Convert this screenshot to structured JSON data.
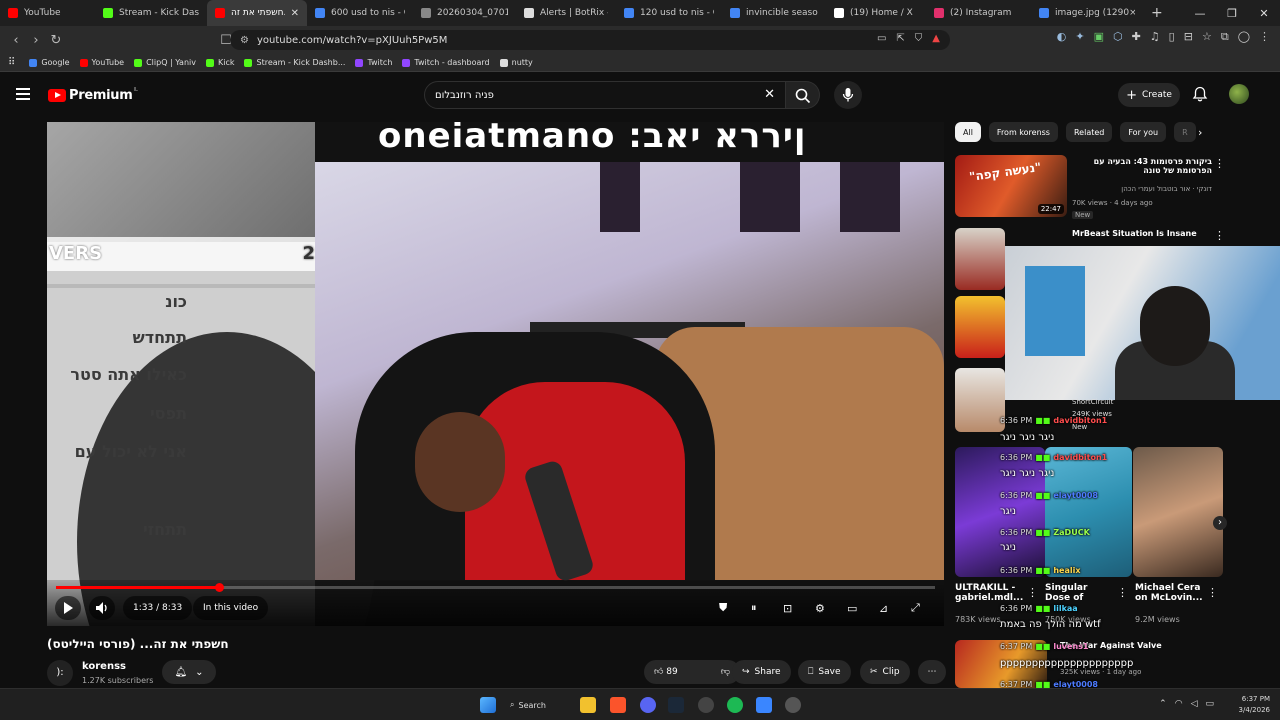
{
  "browser": {
    "tabs": [
      {
        "label": "YouTube",
        "color": "#ff0000",
        "active": false
      },
      {
        "label": "Stream - Kick Dashb...",
        "color": "#53fc18",
        "active": false
      },
      {
        "label": "חשפתי את זה...",
        "color": "#ff0000",
        "active": true
      },
      {
        "label": "600 usd to nis - Google S...",
        "color": "#4285f4",
        "active": false
      },
      {
        "label": "20260304_070131.j...",
        "color": "#888888",
        "active": false
      },
      {
        "label": "Alerts | BotRix — Cl...",
        "color": "#dddddd",
        "active": false
      },
      {
        "label": "120 usd to nis - Goo...",
        "color": "#4285f4",
        "active": false
      },
      {
        "label": "invincible season 4...",
        "color": "#4285f4",
        "active": false
      },
      {
        "label": "(19) Home / X",
        "color": "#ffffff",
        "active": false
      },
      {
        "label": "(2) Instagram",
        "color": "#e1306c",
        "active": false
      },
      {
        "label": "image.jpg (1290×72...",
        "color": "#4285f4",
        "active": false
      }
    ],
    "new_tab": "+",
    "url": "youtube.com/watch?v=pXJUuh5Pw5M",
    "bookmarks": [
      {
        "label": "Google",
        "color": "#4285f4"
      },
      {
        "label": "YouTube",
        "color": "#ff0000"
      },
      {
        "label": "ClipQ | Yaniv",
        "color": "#53fc18"
      },
      {
        "label": "Kick",
        "color": "#53fc18"
      },
      {
        "label": "Stream - Kick Dashb...",
        "color": "#53fc18"
      },
      {
        "label": "Twitch",
        "color": "#9146ff"
      },
      {
        "label": "Twitch - dashboard",
        "color": "#9146ff"
      },
      {
        "label": "nutty",
        "color": "#dddddd"
      }
    ]
  },
  "youtube": {
    "logo_text": "Premium",
    "logo_region": "IL",
    "search_value": "פניה רוזנבלום",
    "create_label": "Create"
  },
  "player": {
    "banner_text": "oneiatmano :ןיררא יאב",
    "left_overlay_text": "VERS",
    "left_number": "2",
    "left_lines": [
      "כונ",
      "תתחדש",
      "כאילו אתה סטר",
      "תפסי",
      "אני לא יכול עם",
      "תתחזי"
    ],
    "time": "1:33 / 8:33",
    "in_this_video": "In this video",
    "progress_fraction": 0.186
  },
  "video": {
    "title": "חשפתי את זה... (פורסי הייליטס)",
    "channel": "korenss",
    "subscribers": "1.27K subscribers",
    "likes": "89",
    "share_label": "Share",
    "save_label": "Save",
    "clip_label": "Clip"
  },
  "sidebar": {
    "chips": [
      "All",
      "From korenss",
      "Related",
      "For you",
      "R"
    ],
    "recommendations": [
      {
        "title": "ביקורת פרסומות 43: הבעיה עם הפרסומת של טונה",
        "channel": "דונקי · אור בוטבול ועמרי הכהן",
        "meta": "70K views · 4 days ago",
        "badge": "New",
        "duration": "22:47"
      },
      {
        "title": "MrBeast Situation Is Insane",
        "channel": "",
        "meta": "",
        "badge": "",
        "duration": ""
      }
    ],
    "overlay_channel": "ShortCircuit",
    "overlay_views": "249K views",
    "overlay_badge": "New",
    "tiles": [
      {
        "title": "ULTRAKILL - gabriel.mdl...",
        "views": "783K views"
      },
      {
        "title": "Singular Dose of",
        "views": "750K views"
      },
      {
        "title": "Michael Cera on McLovin...",
        "views": "9.2M views"
      },
      {
        "title": "The War Against Valve",
        "views": "325K views · 1 day ago"
      }
    ]
  },
  "chat": [
    {
      "time": "6:36 PM",
      "name": "davidbiton1",
      "text": "",
      "color": "#ff4d4d"
    },
    {
      "time": "",
      "name": "",
      "text": "ניגר ניגר ניגר",
      "color": "#ffffff"
    },
    {
      "time": "6:36 PM",
      "name": "davidbiton1",
      "text": "",
      "color": "#ff4d4d"
    },
    {
      "time": "",
      "name": "",
      "text": "ניגר ניגר ניגר",
      "color": "#ffffff"
    },
    {
      "time": "6:36 PM",
      "name": "elayt0008",
      "text": "",
      "color": "#4d7bff"
    },
    {
      "time": "",
      "name": "",
      "text": "ניגר",
      "color": "#ffffff"
    },
    {
      "time": "6:36 PM",
      "name": "ZaDUCK",
      "text": "",
      "color": "#9cff4d"
    },
    {
      "time": "",
      "name": "",
      "text": "ניגר",
      "color": "#ffffff"
    },
    {
      "time": "6:36 PM",
      "name": "healix",
      "text": "",
      "color": "#ffd84d"
    },
    {
      "time": "6:36 PM",
      "name": "lilkaa",
      "text": "",
      "color": "#4dd2ff"
    },
    {
      "time": "",
      "name": "",
      "text": "מה הולך פה באמת wtf",
      "color": "#ffffff"
    },
    {
      "time": "6:37 PM",
      "name": "luvens1",
      "text": "",
      "color": "#ff8bd0"
    },
    {
      "time": "",
      "name": "",
      "text": "ppppppppppppppppppppp",
      "color": "#ffffff"
    },
    {
      "time": "6:37 PM",
      "name": "elayt0008",
      "text": "",
      "color": "#4d7bff"
    },
    {
      "time": "",
      "name": "",
      "text": "ניגר ניגר ניגר ניגר ניגר",
      "color": "#ffffff"
    }
  ],
  "taskbar": {
    "search_label": "Search",
    "time": "6:37 PM",
    "date": "3/4/2026"
  }
}
